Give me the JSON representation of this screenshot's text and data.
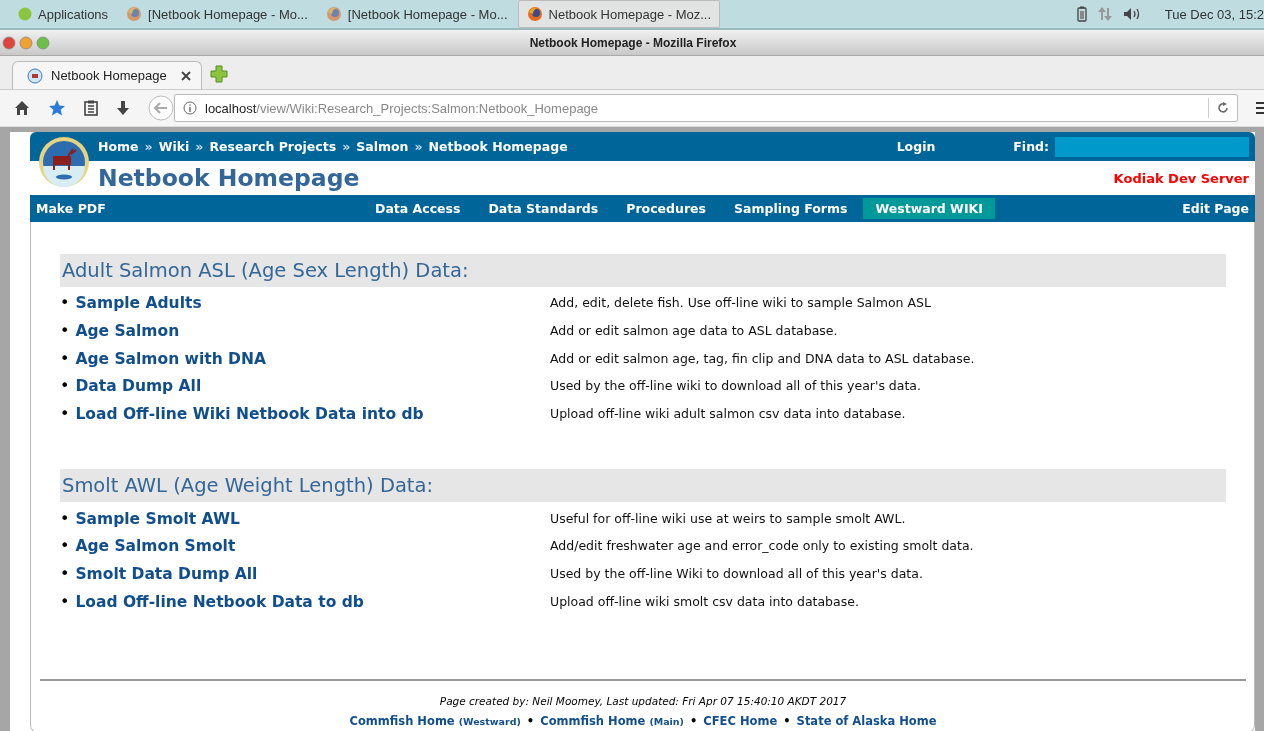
{
  "taskbar": {
    "apps_label": "Applications",
    "tasks": [
      {
        "label": "[Netbook Homepage - Mo...",
        "selected": false
      },
      {
        "label": "[Netbook Homepage - Mo...",
        "selected": false
      },
      {
        "label": "Netbook Homepage - Moz...",
        "selected": true
      }
    ],
    "clock": "Tue Dec 03, 15:2"
  },
  "window": {
    "title": "Netbook Homepage - Mozilla Firefox"
  },
  "browser": {
    "tab": {
      "title": "Netbook Homepage"
    },
    "url": {
      "host": "localhost",
      "path": "/view/Wiki:Research_Projects:Salmon:Netbook_Homepage"
    }
  },
  "site": {
    "breadcrumb": [
      "Home",
      "Wiki",
      "Research Projects",
      "Salmon",
      "Netbook Homepage"
    ],
    "separator": "»",
    "login": "Login",
    "find_label": "Find:",
    "title": "Netbook Homepage",
    "server_label": "Kodiak Dev Server",
    "make_pdf": "Make PDF",
    "nav": [
      {
        "label": "Data Access",
        "selected": false
      },
      {
        "label": "Data Standards",
        "selected": false
      },
      {
        "label": "Procedures",
        "selected": false
      },
      {
        "label": "Sampling Forms",
        "selected": false
      },
      {
        "label": "Westward WIKI",
        "selected": true
      }
    ],
    "edit_page": "Edit Page"
  },
  "sections": [
    {
      "heading": "Adult Salmon ASL (Age Sex Length) Data:",
      "items": [
        {
          "bullet": "•",
          "link": "Sample Adults",
          "description": "Add, edit, delete fish. Use off-line wiki to sample Salmon ASL"
        },
        {
          "bullet": "•",
          "link": "Age Salmon",
          "description": "Add or edit salmon age data to ASL database."
        },
        {
          "bullet": "•",
          "link": "Age Salmon with DNA",
          "description": "Add or edit salmon age, tag, fin clip and DNA data to ASL database."
        },
        {
          "bullet": "•",
          "link": "Data Dump All",
          "description": "Used by the off-line wiki to download all of this year's data."
        },
        {
          "bullet": "•",
          "link": "Load Off-line Wiki Netbook Data into db",
          "description": "Upload off-line wiki adult salmon csv data into database."
        }
      ]
    },
    {
      "heading": "Smolt AWL (Age Weight Length) Data:",
      "items": [
        {
          "bullet": "•",
          "link": "Sample Smolt AWL",
          "description": "Useful for off-line wiki use at weirs to sample smolt AWL."
        },
        {
          "bullet": "•",
          "link": "Age Salmon Smolt",
          "description": "Add/edit freshwater age and error_code only to existing smolt data."
        },
        {
          "bullet": "•",
          "link": "Smolt Data Dump All",
          "description": "Used by the off-line Wiki to download all of this year's data."
        },
        {
          "bullet": "•",
          "link": "Load Off-line Netbook Data to db",
          "description": "Upload off-line wiki smolt csv data into database."
        }
      ]
    }
  ],
  "footer": {
    "credit": "Page created by: Neil Moomey, Last updated: Fri Apr 07 15:40:10 AKDT 2017",
    "separator": "•",
    "links": [
      {
        "label": "Commfish Home",
        "note": "(Westward)"
      },
      {
        "label": "Commfish Home",
        "note": "(Main)"
      },
      {
        "label": "CFEC Home"
      },
      {
        "label": "State of Alaska Home"
      }
    ]
  }
}
